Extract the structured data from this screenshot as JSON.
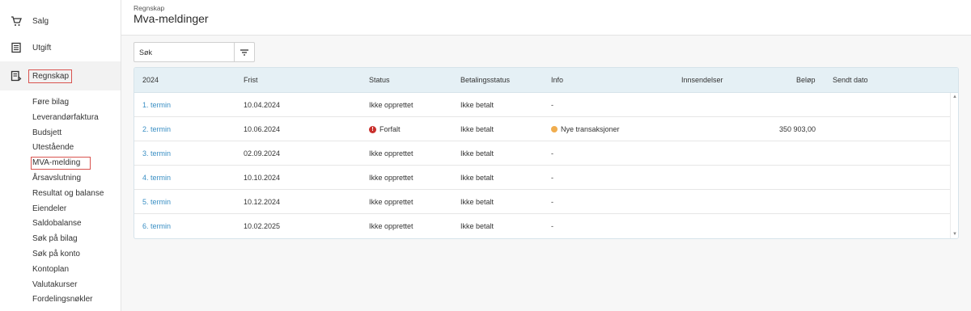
{
  "sidebar": {
    "items": [
      {
        "label": "Salg",
        "icon": "cart-icon"
      },
      {
        "label": "Utgift",
        "icon": "ledger-icon"
      },
      {
        "label": "Regnskap",
        "icon": "accounting-icon"
      }
    ],
    "subitems": [
      "Føre bilag",
      "Leverandørfaktura",
      "Budsjett",
      "Utestående",
      "MVA-melding",
      "Årsavslutning",
      "Resultat og balanse",
      "Eiendeler",
      "Saldobalanse",
      "Søk på bilag",
      "Søk på konto",
      "Kontoplan",
      "Valutakurser",
      "Fordelingsnøkler"
    ]
  },
  "header": {
    "breadcrumb": "Regnskap",
    "title": "Mva-meldinger"
  },
  "search": {
    "placeholder": "Søk"
  },
  "table": {
    "columns": [
      "2024",
      "Frist",
      "Status",
      "Betalingsstatus",
      "Info",
      "Innsendelser",
      "Beløp",
      "Sendt dato"
    ],
    "rows": [
      {
        "termin": "1. termin",
        "frist": "10.04.2024",
        "status": "Ikke opprettet",
        "betaling": "Ikke betalt",
        "info": "-",
        "innsendelser": "",
        "belop": "",
        "sendt": ""
      },
      {
        "termin": "2. termin",
        "frist": "10.06.2024",
        "status": "Forfalt",
        "betaling": "Ikke betalt",
        "info": "Nye transaksjoner",
        "innsendelser": "",
        "belop": "350 903,00",
        "sendt": ""
      },
      {
        "termin": "3. termin",
        "frist": "02.09.2024",
        "status": "Ikke opprettet",
        "betaling": "Ikke betalt",
        "info": "-",
        "innsendelser": "",
        "belop": "",
        "sendt": ""
      },
      {
        "termin": "4. termin",
        "frist": "10.10.2024",
        "status": "Ikke opprettet",
        "betaling": "Ikke betalt",
        "info": "-",
        "innsendelser": "",
        "belop": "",
        "sendt": ""
      },
      {
        "termin": "5. termin",
        "frist": "10.12.2024",
        "status": "Ikke opprettet",
        "betaling": "Ikke betalt",
        "info": "-",
        "innsendelser": "",
        "belop": "",
        "sendt": ""
      },
      {
        "termin": "6. termin",
        "frist": "10.02.2025",
        "status": "Ikke opprettet",
        "betaling": "Ikke betalt",
        "info": "-",
        "innsendelser": "",
        "belop": "",
        "sendt": ""
      }
    ]
  },
  "colors": {
    "link": "#3a8fc4",
    "error": "#c9302c",
    "warning": "#f0ad4e",
    "highlight_box": "#d9534f",
    "table_header": "#e5f0f5"
  }
}
